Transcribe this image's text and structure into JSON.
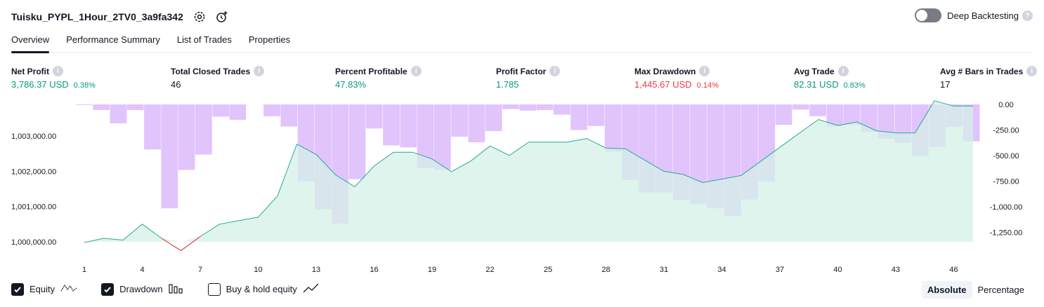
{
  "header": {
    "title": "Tuisku_PYPL_1Hour_2TV0_3a9fa342",
    "settings_icon": "gear-icon",
    "alert_icon": "add-alert-icon"
  },
  "deep_backtesting": {
    "label": "Deep Backtesting",
    "enabled": false
  },
  "tabs": [
    {
      "label": "Overview",
      "active": true
    },
    {
      "label": "Performance Summary",
      "active": false
    },
    {
      "label": "List of Trades",
      "active": false
    },
    {
      "label": "Properties",
      "active": false
    }
  ],
  "metrics": [
    {
      "label": "Net Profit",
      "value": "3,786.37 USD",
      "pct": "0.38%",
      "tone": "green"
    },
    {
      "label": "Total Closed Trades",
      "value": "46",
      "pct": "",
      "tone": "dark"
    },
    {
      "label": "Percent Profitable",
      "value": "47.83%",
      "pct": "",
      "tone": "green"
    },
    {
      "label": "Profit Factor",
      "value": "1.785",
      "pct": "",
      "tone": "green"
    },
    {
      "label": "Max Drawdown",
      "value": "1,445.67 USD",
      "pct": "0.14%",
      "tone": "red"
    },
    {
      "label": "Avg Trade",
      "value": "82.31 USD",
      "pct": "0.83%",
      "tone": "green"
    },
    {
      "label": "Avg # Bars in Trades",
      "value": "17",
      "pct": "",
      "tone": "dark"
    }
  ],
  "colors": {
    "equity_line": "#22ab94",
    "equity_fill": "#d6f0e8",
    "equity_below": "#f23645",
    "drawdown_bar": "#e1c4fc",
    "drawdown_overlap": "#c2b3f0"
  },
  "chart_data": [
    {
      "type": "area",
      "series": [
        {
          "name": "Equity",
          "x": [
            1,
            2,
            3,
            4,
            5,
            6,
            7,
            8,
            9,
            10,
            11,
            12,
            13,
            14,
            15,
            16,
            17,
            18,
            19,
            20,
            21,
            22,
            23,
            24,
            25,
            26,
            27,
            28,
            29,
            30,
            31,
            32,
            33,
            34,
            35,
            36,
            37,
            38,
            39,
            40,
            41,
            42,
            43,
            44,
            45,
            46,
            47
          ],
          "values": [
            999980,
            1000100,
            1000050,
            1000500,
            1000100,
            999750,
            1000150,
            1000500,
            1000600,
            1000700,
            1001300,
            1002770,
            1002480,
            1001900,
            1001560,
            1002150,
            1002540,
            1002540,
            1002350,
            1001990,
            1002290,
            1002720,
            1002450,
            1002830,
            1002830,
            1002830,
            1002930,
            1002660,
            1002640,
            1002320,
            1002000,
            1001910,
            1001680,
            1001780,
            1001880,
            1002280,
            1002680,
            1003080,
            1003470,
            1003300,
            1003400,
            1003150,
            1003090,
            1003090,
            1004000,
            1003850,
            1003850
          ]
        }
      ],
      "y_ticks": [
        "1,000,000.00",
        "1,001,000.00",
        "1,002,000.00",
        "1,003,000.00"
      ],
      "x_ticks": [
        "1",
        "4",
        "7",
        "10",
        "13",
        "16",
        "19",
        "22",
        "25",
        "28",
        "31",
        "34",
        "37",
        "40",
        "43",
        "46"
      ]
    },
    {
      "type": "bar",
      "series": [
        {
          "name": "Drawdown",
          "values": [
            -5,
            -55,
            -185,
            -55,
            -440,
            -1015,
            -640,
            -490,
            -120,
            -150,
            0,
            -115,
            -215,
            -750,
            -1025,
            -1165,
            -730,
            -235,
            -400,
            -420,
            -620,
            -640,
            -315,
            -370,
            -260,
            -45,
            -60,
            -55,
            -100,
            -250,
            -210,
            -460,
            -740,
            -860,
            -860,
            -935,
            -975,
            -1015,
            -1090,
            -930,
            -755,
            -200,
            -50,
            -115,
            -215,
            -200,
            -270,
            -335,
            -375,
            -505,
            -415,
            -220,
            -360
          ]
        }
      ],
      "y_ticks": [
        "0.00",
        "-250.00",
        "-500.00",
        "-750.00",
        "-1,000.00",
        "-1,250.00"
      ]
    }
  ],
  "legend": [
    {
      "label": "Equity",
      "checked": true,
      "glyph": "equity-line-icon"
    },
    {
      "label": "Drawdown",
      "checked": true,
      "glyph": "drawdown-bars-icon"
    },
    {
      "label": "Buy & hold equity",
      "checked": false,
      "glyph": "trend-line-icon"
    }
  ],
  "mode": {
    "absolute": "Absolute",
    "percentage": "Percentage",
    "selected": "absolute"
  }
}
